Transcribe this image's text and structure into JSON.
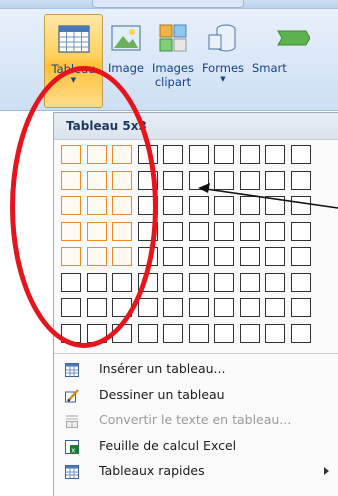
{
  "ribbon": {
    "buttons": [
      {
        "id": "tableau",
        "label": "Tableau",
        "dropdown": true
      },
      {
        "id": "image",
        "label": "Image"
      },
      {
        "id": "clipart",
        "label": "Images clipart"
      },
      {
        "id": "formes",
        "label": "Formes",
        "dropdown": true
      },
      {
        "id": "smart",
        "label": "Smart"
      }
    ]
  },
  "dropdown": {
    "header": "Tableau 5x3",
    "grid": {
      "columns": 10,
      "rows": 8,
      "selected_columns": 3,
      "selected_rows": 5
    },
    "menu": [
      {
        "label": "Insérer un tableau...",
        "icon": "table-icon",
        "enabled": true,
        "submenu": false
      },
      {
        "label": "Dessiner un tableau",
        "icon": "pencil-icon",
        "enabled": true,
        "submenu": false
      },
      {
        "label": "Convertir le texte en tableau...",
        "icon": "convert-text-icon",
        "enabled": false,
        "submenu": false
      },
      {
        "label": "Feuille de calcul Excel",
        "icon": "excel-icon",
        "enabled": true,
        "submenu": false
      },
      {
        "label": "Tableaux rapides",
        "icon": "table-icon",
        "enabled": true,
        "submenu": true
      }
    ]
  },
  "colors": {
    "selection": "#f08a24",
    "annotation": "#e8141b",
    "ribbon_text": "#15428b"
  }
}
